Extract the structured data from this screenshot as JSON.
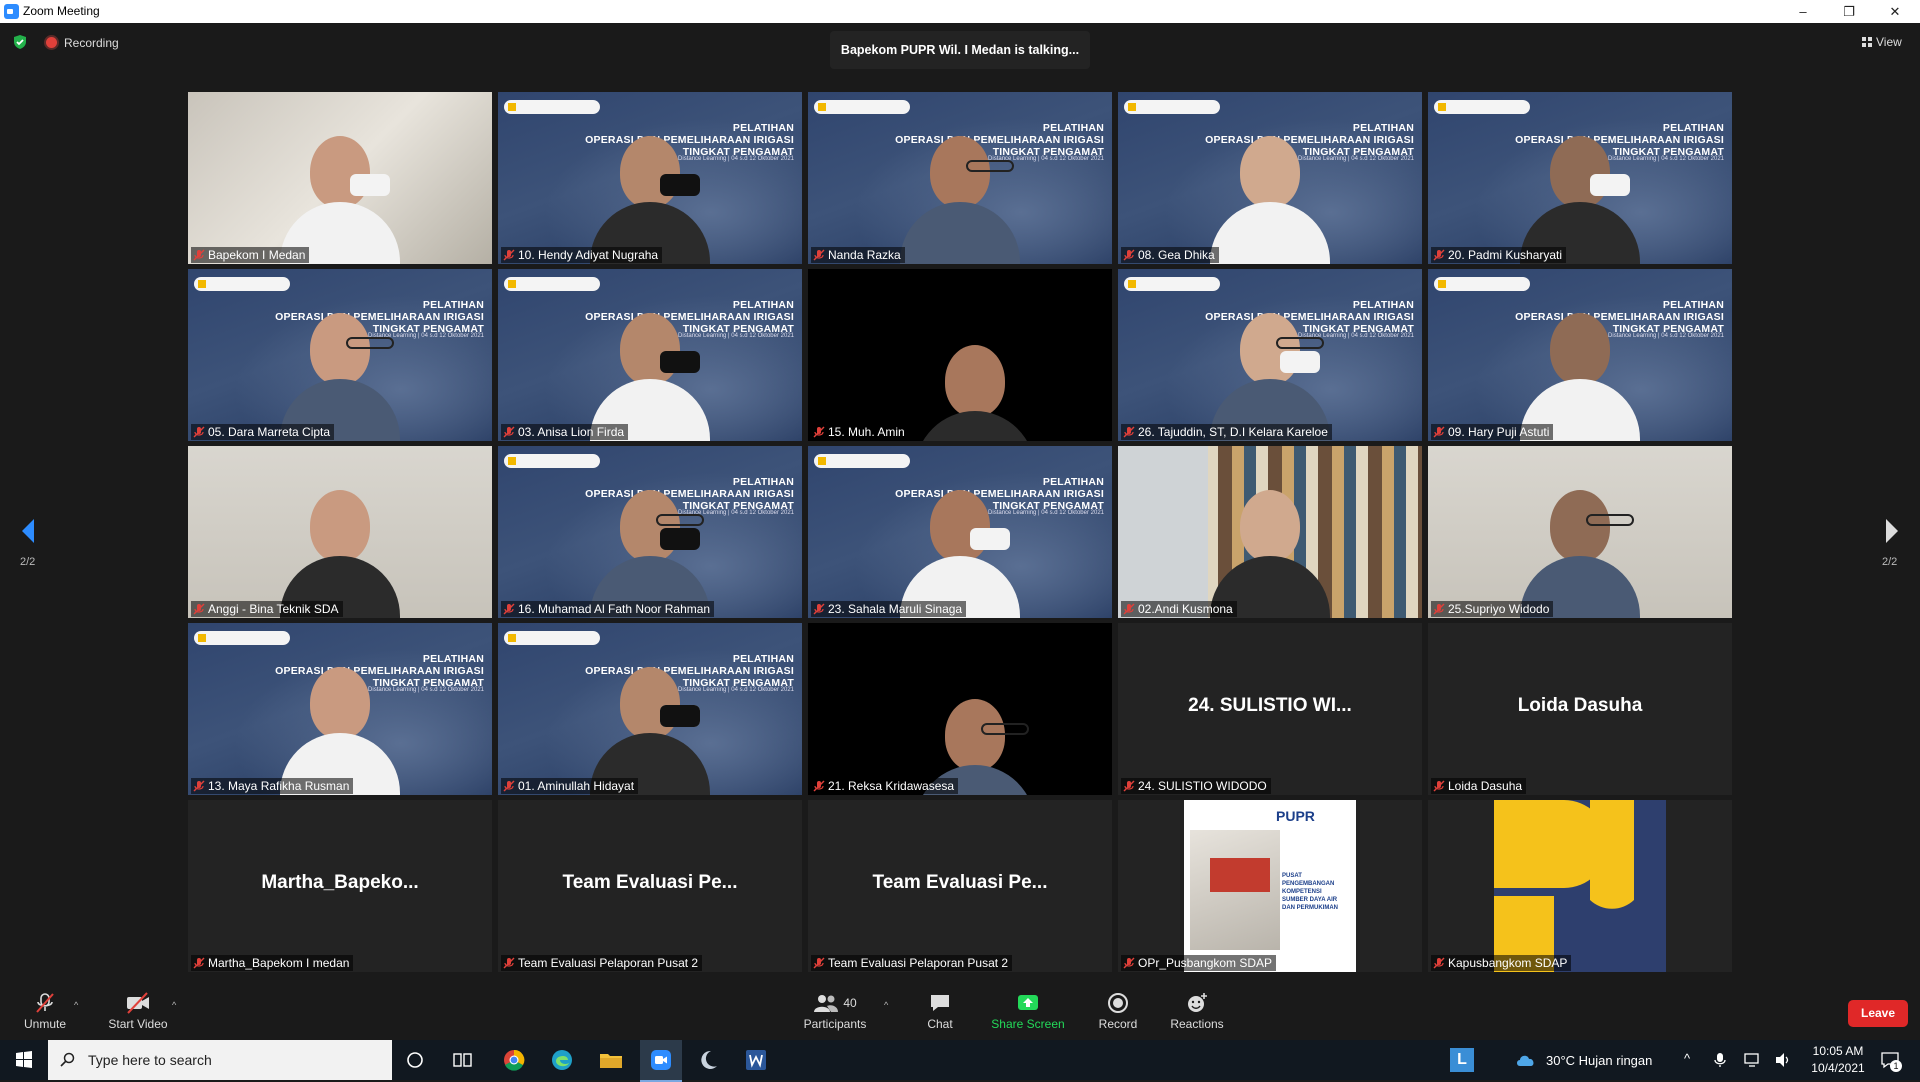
{
  "window": {
    "title": "Zoom Meeting",
    "min": "–",
    "restore": "❐",
    "close": "✕"
  },
  "top": {
    "recording": "Recording",
    "talking": "Bapekom PUPR Wil. I Medan is talking...",
    "view": "View"
  },
  "paging": {
    "left": "2/2",
    "right": "2/2"
  },
  "slide": {
    "title_line1": "PELATIHAN",
    "title_line2": "OPERASI DAN PEMELIHARAAN IRIGASI",
    "title_line3": "TINGKAT PENGAMAT",
    "sub": "Distance Learning | 04 s.d 12 Oktober 2021"
  },
  "tiles": [
    {
      "name": "Bapekom I Medan",
      "kind": "photo-wall"
    },
    {
      "name": "10. Hendy Adiyat Nugraha",
      "kind": "slide"
    },
    {
      "name": "Nanda Razka",
      "kind": "slide"
    },
    {
      "name": "08. Gea Dhika",
      "kind": "slide"
    },
    {
      "name": "20. Padmi Kusharyati",
      "kind": "slide"
    },
    {
      "name": "05. Dara Marreta Cipta",
      "kind": "slide"
    },
    {
      "name": "03. Anisa Lion Firda",
      "kind": "slide"
    },
    {
      "name": "15. Muh. Amin",
      "kind": "black"
    },
    {
      "name": "26. Tajuddin, ST, D.I Kelara Kareloe",
      "kind": "slide"
    },
    {
      "name": "09. Hary Puji Astuti",
      "kind": "slide"
    },
    {
      "name": "Anggi - Bina Teknik SDA",
      "kind": "photo-room"
    },
    {
      "name": "16. Muhamad Al Fath Noor Rahman",
      "kind": "slide"
    },
    {
      "name": "23. Sahala Maruli Sinaga",
      "kind": "slide"
    },
    {
      "name": "02.Andi Kusmona",
      "kind": "books"
    },
    {
      "name": "25.Supriyo Widodo",
      "kind": "photo-room"
    },
    {
      "name": "13. Maya Rafikha Rusman",
      "kind": "slide"
    },
    {
      "name": "01. Aminullah Hidayat",
      "kind": "slide"
    },
    {
      "name": "21. Reksa Kridawasesa",
      "kind": "black"
    },
    {
      "name": "24. SULISTIO WIDODO",
      "kind": "name",
      "big": "24. SULISTIO WI..."
    },
    {
      "name": "Loida Dasuha",
      "kind": "name",
      "big": "Loida Dasuha"
    },
    {
      "name": "Martha_Bapekom I medan",
      "kind": "name",
      "big": "Martha_Bapeko..."
    },
    {
      "name": "Team Evaluasi Pelaporan Pusat 2",
      "kind": "name",
      "big": "Team Evaluasi Pe..."
    },
    {
      "name": "Team Evaluasi Pelaporan Pusat 2",
      "kind": "name",
      "big": "Team Evaluasi Pe..."
    },
    {
      "name": "OPr_Pusbangkom SDAP",
      "kind": "pupr"
    },
    {
      "name": "Kapusbangkom SDAP",
      "kind": "kap"
    }
  ],
  "pupr_card": {
    "header": "PUPR",
    "text_line1": "PUSAT",
    "text_line2": "PENGEMBANGAN",
    "text_line3": "KOMPETENSI",
    "text_line4": "SUMBER DAYA AIR",
    "text_line5": "DAN PERMUKIMAN"
  },
  "toolbar": {
    "unmute": "Unmute",
    "start_video": "Start Video",
    "participants": "Participants",
    "participants_count": "40",
    "chat": "Chat",
    "share_screen": "Share Screen",
    "record": "Record",
    "reactions": "Reactions",
    "leave": "Leave"
  },
  "taskbar": {
    "search_placeholder": "Type here to search",
    "weather": "30°C  Hujan ringan",
    "time": "10:05 AM",
    "date": "10/4/2021",
    "notif_count": "1"
  },
  "colors": {
    "accent": "#2d8cff",
    "leave": "#e02828",
    "share": "#23d959",
    "taskbar": "#111820"
  }
}
